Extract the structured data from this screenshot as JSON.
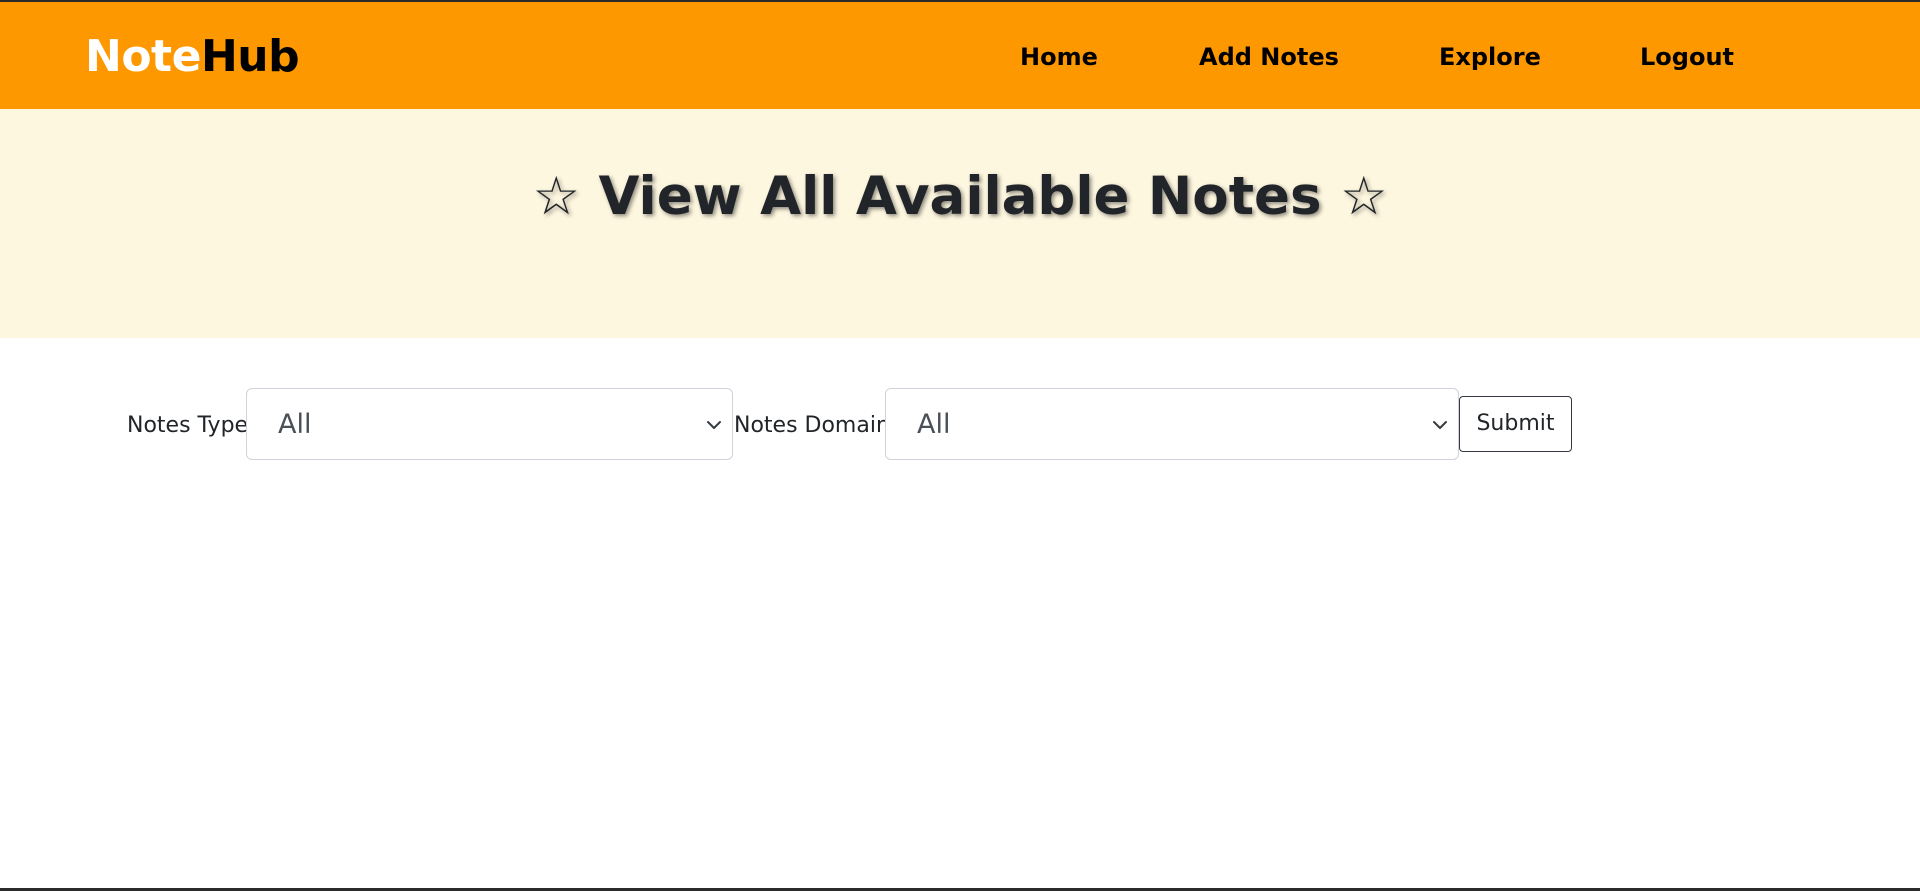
{
  "navbar": {
    "brand_part1": "Note",
    "brand_part2": "Hub",
    "links": [
      {
        "label": "Home"
      },
      {
        "label": "Add Notes"
      },
      {
        "label": "Explore"
      },
      {
        "label": "Logout"
      }
    ]
  },
  "hero": {
    "title": "☆ View All Available Notes ☆"
  },
  "filters": {
    "type_label": "Notes Type",
    "type_value": "All",
    "domain_label": "Notes Domain",
    "domain_value": "All",
    "submit_label": "Submit"
  },
  "colors": {
    "navbar_bg": "#fe9800",
    "hero_bg": "#fef7e0"
  },
  "icons": {
    "select_arrow": "chevron-down-icon"
  }
}
